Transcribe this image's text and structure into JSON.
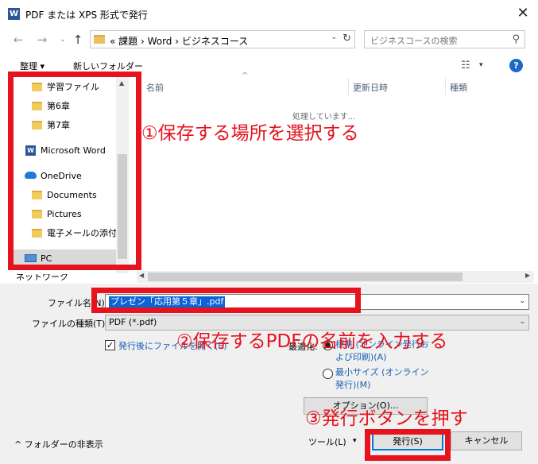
{
  "window": {
    "title": "PDF または XPS 形式で発行",
    "app_icon": "W",
    "close_glyph": "✕"
  },
  "navbar": {
    "back_glyph": "←",
    "forward_glyph": "→",
    "recent_glyph": "⌄",
    "up_glyph": "↑",
    "address": "«  課題  ›  Word  ›  ビジネスコース",
    "address_drop": "⌄",
    "refresh_glyph": "↻",
    "search_placeholder": "ビジネスコースの検索",
    "search_glyph": "⚲"
  },
  "toolbar": {
    "organize": "整理 ▾",
    "new_folder": "新しいフォルダー",
    "view_glyph": "☷",
    "view_drop": "▾",
    "help": "?"
  },
  "nav_tree": {
    "items": [
      {
        "label": "学習ファイル",
        "icon": "folder-icon"
      },
      {
        "label": "第6章",
        "icon": "folder-icon"
      },
      {
        "label": "第7章",
        "icon": "folder-icon"
      },
      {
        "label": "Microsoft Word",
        "icon": "word-icon"
      },
      {
        "label": "OneDrive",
        "icon": "onedrive-cloud-icon"
      },
      {
        "label": "Documents",
        "icon": "folder-icon"
      },
      {
        "label": "Pictures",
        "icon": "folder-icon"
      },
      {
        "label": "電子メールの添付フ",
        "icon": "folder-icon"
      },
      {
        "label": "PC",
        "icon": "pc-icon"
      }
    ],
    "partial_item": "ネットワーク",
    "word_icon_letter": "W",
    "scroll_up": "▲",
    "scroll_down": "▼"
  },
  "file_list": {
    "columns": [
      "名前",
      "更新日時",
      "種類"
    ],
    "sort_glyph": "^",
    "status_text": "処理しています...",
    "scroll_left": "◀",
    "scroll_right": "▶"
  },
  "form": {
    "filename_label": "ファイル名(N):",
    "filename_value": "プレゼン「応用第５章」.pdf",
    "filename_drop": "⌄",
    "filetype_label": "ファイルの種類(T):",
    "filetype_value": "PDF (*.pdf)",
    "filetype_drop": "⌄",
    "open_after_publish": "発行後にファイルを開く(E)",
    "open_after_checked": "✓",
    "optimize_label": "最適化:",
    "opt_standard": "標準 (オンライン発行および印刷)(A)",
    "opt_minimum": "最小サイズ (オンライン発行)(M)",
    "options_button": "オプション(O)..."
  },
  "footer": {
    "hide_folders": "^  フォルダーの非表示",
    "tools": "ツール(L)",
    "tools_drop": "▾",
    "publish": "発行(S)",
    "cancel": "キャンセル"
  },
  "annotations": {
    "step1": "①保存する場所を選択する",
    "step2": "②保存するPDFの名前を入力する",
    "step3": "③発行ボタンを押す",
    "color": "#e6121d"
  }
}
